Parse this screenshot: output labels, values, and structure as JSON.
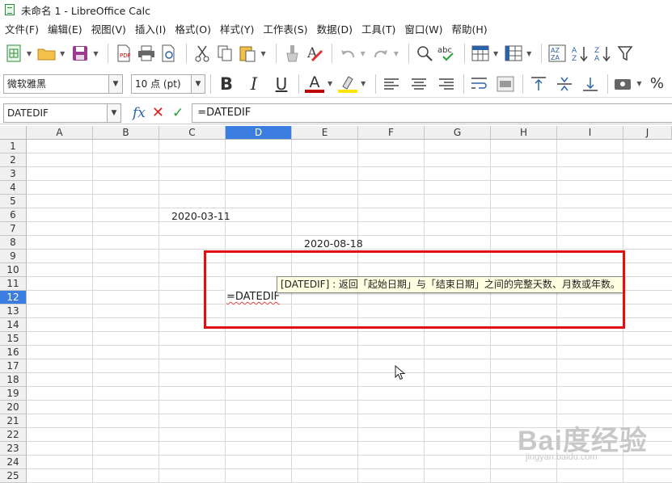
{
  "window": {
    "title": "未命名 1 - LibreOffice Calc"
  },
  "menu": [
    "文件(F)",
    "编辑(E)",
    "视图(V)",
    "插入(I)",
    "格式(O)",
    "样式(Y)",
    "工作表(S)",
    "数据(D)",
    "工具(T)",
    "窗口(W)",
    "帮助(H)"
  ],
  "format": {
    "font_name": "微软雅黑",
    "font_size": "10 点 (pt)",
    "bold": "B",
    "italic": "I",
    "underline": "U",
    "font_color_letter": "A"
  },
  "formula_bar": {
    "name_box": "DATEDIF",
    "formula": "=DATEDIF"
  },
  "columns": [
    "A",
    "B",
    "C",
    "D",
    "E",
    "F",
    "G",
    "H",
    "I",
    "J"
  ],
  "rows": [
    "1",
    "2",
    "3",
    "4",
    "5",
    "6",
    "7",
    "8",
    "9",
    "10",
    "11",
    "12",
    "13",
    "14",
    "15",
    "16",
    "17",
    "18",
    "19",
    "20",
    "21",
    "22",
    "23",
    "24",
    "25"
  ],
  "active": {
    "column": "D",
    "row": "12"
  },
  "cells": {
    "c6": "2020-03-11",
    "e8": "2020-08-18",
    "d12": "=DATEDIF"
  },
  "tooltip": "[DATEDIF] : 返回「起始日期」与「结束日期」之间的完整天数、月数或年数。",
  "watermark": {
    "brand": "Bai度经验",
    "url": "jingyan.baidu.com"
  },
  "colors": {
    "accent": "#3b7de0",
    "highlight_box": "#e01010",
    "tooltip_bg": "#ffffe1"
  }
}
